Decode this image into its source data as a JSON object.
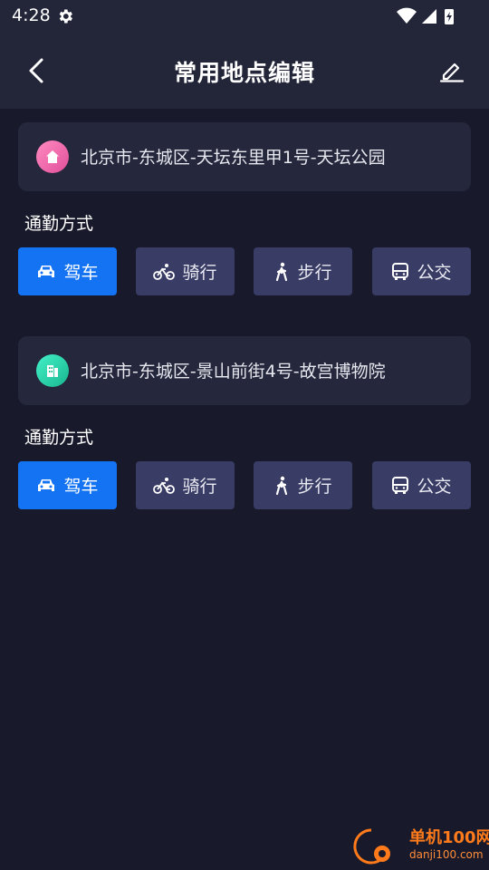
{
  "status": {
    "time": "4:28"
  },
  "appbar": {
    "title": "常用地点编辑"
  },
  "places": [
    {
      "type": "home",
      "address": "北京市-东城区-天坛东里甲1号-天坛公园",
      "commute_label": "通勤方式",
      "modes": [
        {
          "label": "驾车",
          "icon": "car-icon",
          "active": true
        },
        {
          "label": "骑行",
          "icon": "bike-icon",
          "active": false
        },
        {
          "label": "步行",
          "icon": "walk-icon",
          "active": false
        },
        {
          "label": "公交",
          "icon": "bus-icon",
          "active": false
        }
      ]
    },
    {
      "type": "work",
      "address": "北京市-东城区-景山前街4号-故宫博物院",
      "commute_label": "通勤方式",
      "modes": [
        {
          "label": "驾车",
          "icon": "car-icon",
          "active": true
        },
        {
          "label": "骑行",
          "icon": "bike-icon",
          "active": false
        },
        {
          "label": "步行",
          "icon": "walk-icon",
          "active": false
        },
        {
          "label": "公交",
          "icon": "bus-icon",
          "active": false
        }
      ]
    }
  ],
  "colors": {
    "background": "#181a2b",
    "appbar": "#232539",
    "card": "#25273c",
    "mode_inactive": "#393c64",
    "mode_active": "#1373f2"
  },
  "watermark": {
    "title": "单机100网",
    "url": "danji100.com"
  }
}
